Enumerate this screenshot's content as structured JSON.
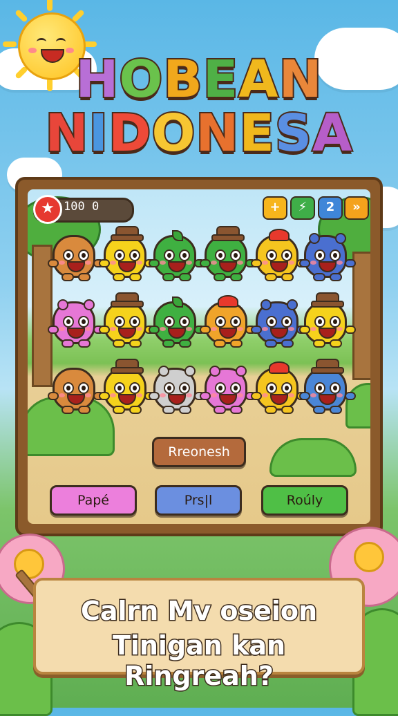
{
  "title": {
    "line1": [
      "H",
      "O",
      "B",
      "E",
      "A",
      "N"
    ],
    "line2": [
      "N",
      "I",
      "D",
      "O",
      "N",
      "E",
      "S",
      "A"
    ],
    "line1_colors": [
      "#b86fd6",
      "#6ac24c",
      "#f1a81c",
      "#4fb046",
      "#f0b81d",
      "#e9873a"
    ],
    "line2_colors": [
      "#e8463a",
      "#4a96e0",
      "#ee4a38",
      "#f7c632",
      "#e7712e",
      "#f0b81d",
      "#5a8fe3",
      "#b65ec9"
    ]
  },
  "hud": {
    "score_icon": "star-icon",
    "score": "100  0",
    "buttons": [
      {
        "name": "plus-button",
        "label": "+",
        "color": "#f7b51c",
        "icon": "plus-icon"
      },
      {
        "name": "bolt-button",
        "label": "⚡",
        "color": "#3fae48",
        "icon": "lightning-icon"
      },
      {
        "name": "level-button",
        "label": "2",
        "color": "#3f86d8",
        "icon": ""
      },
      {
        "name": "next-button",
        "label": "»",
        "color": "#f4a21c",
        "icon": "double-arrow-icon"
      }
    ]
  },
  "creatures": [
    [
      {
        "color": "#d98a3d",
        "acc": "none"
      },
      {
        "color": "#f5d21c",
        "acc": "hat"
      },
      {
        "color": "#3fb041",
        "acc": "leaf"
      },
      {
        "color": "#3fb041",
        "acc": "hat"
      },
      {
        "color": "#f5c51f",
        "acc": "crest"
      },
      {
        "color": "#4a6fd0",
        "acc": "ears"
      }
    ],
    [
      {
        "color": "#e677d6",
        "acc": "ears"
      },
      {
        "color": "#f5d21c",
        "acc": "hat"
      },
      {
        "color": "#3fb041",
        "acc": "leaf"
      },
      {
        "color": "#f0a42a",
        "acc": "crest"
      },
      {
        "color": "#4a6fd0",
        "acc": "ears"
      },
      {
        "color": "#f5d21c",
        "acc": "hat"
      }
    ],
    [
      {
        "color": "#d98a3d",
        "acc": "none"
      },
      {
        "color": "#f5d21c",
        "acc": "hat"
      },
      {
        "color": "#cfcfcf",
        "acc": "ears"
      },
      {
        "color": "#e677d6",
        "acc": "ears"
      },
      {
        "color": "#f5c51f",
        "acc": "crest"
      },
      {
        "color": "#4a86d6",
        "acc": "hat"
      }
    ]
  ],
  "center_button": {
    "label": "Rreonesh",
    "color": "#b46a3c"
  },
  "action_buttons": [
    {
      "name": "pape-button",
      "label": "Papé",
      "color": "#ec7fdc"
    },
    {
      "name": "prsil-button",
      "label": "Prs|l",
      "color": "#6b8fe0"
    },
    {
      "name": "rouly-button",
      "label": "Roúly",
      "color": "#4fbf46"
    }
  ],
  "banner": {
    "line1": "Calrn Mv oseion",
    "line2": "Tinigan kan Ringreah?"
  }
}
